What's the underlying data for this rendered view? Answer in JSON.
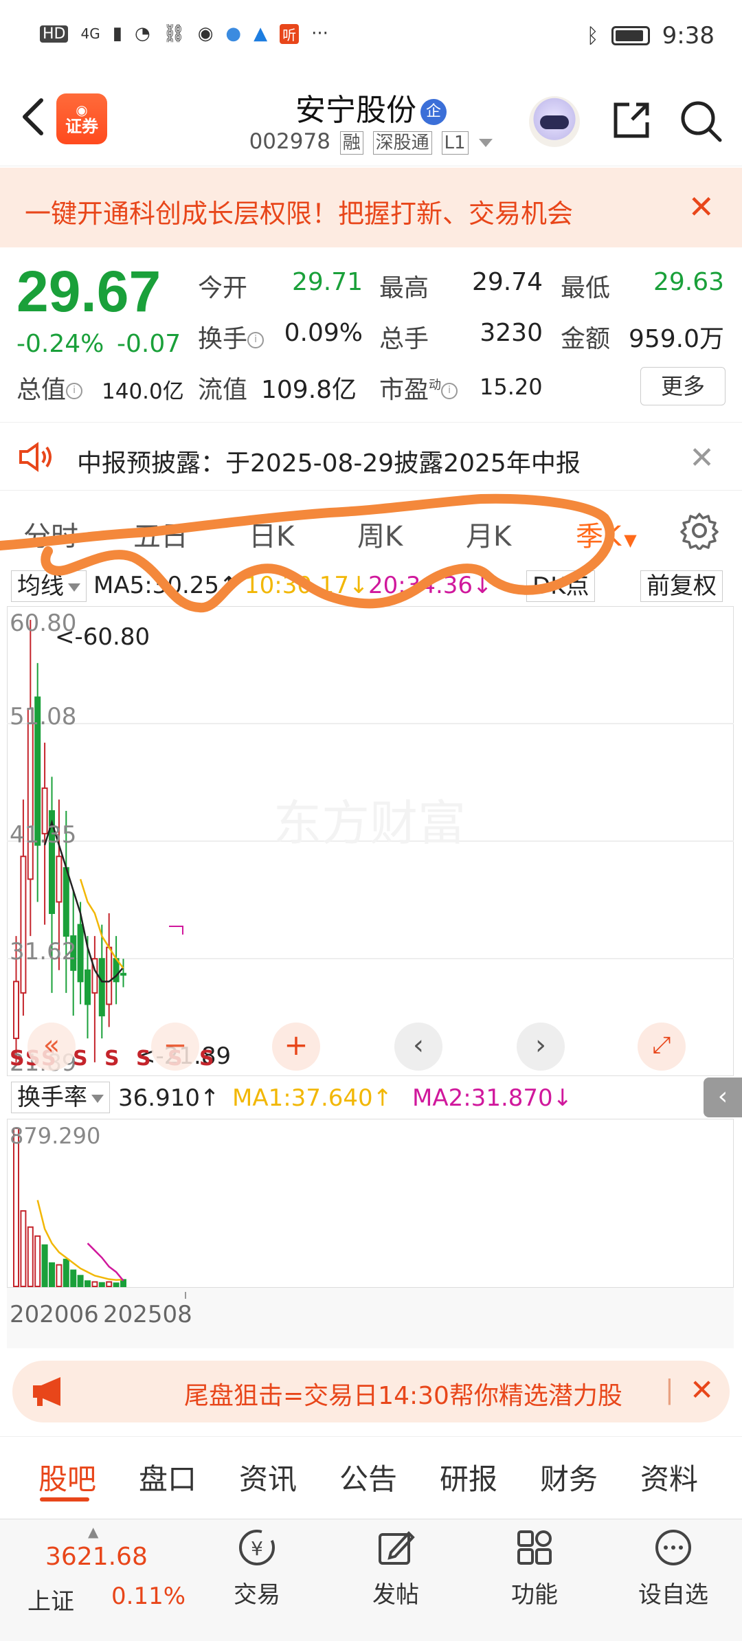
{
  "status": {
    "time": "9:38",
    "network": "4G",
    "hd": "HD",
    "more": "···"
  },
  "header": {
    "stock_name": "安宁股份",
    "badge": "企",
    "code": "002978",
    "tags": [
      "融",
      "深股通",
      "L1"
    ],
    "logo_text": "证券"
  },
  "promo": {
    "text": "一键开通科创成长层权限！把握打新、交易机会",
    "close": "✕"
  },
  "quote": {
    "price": "29.67",
    "change_pct": "-0.24%",
    "change_amt": "-0.07",
    "open_label": "今开",
    "open": "29.71",
    "high_label": "最高",
    "high": "29.74",
    "low_label": "最低",
    "low": "29.63",
    "turnover_label": "换手",
    "turnover": "0.09%",
    "volume_label": "总手",
    "volume": "3230",
    "amount_label": "金额",
    "amount": "959.0万",
    "mktcap_label": "总值",
    "mktcap": "140.0亿",
    "float_label": "流值",
    "float": "109.8亿",
    "pe_label": "市盈",
    "pe_sup": "动",
    "pe": "15.20",
    "more": "更多"
  },
  "notice": {
    "text": "中报预披露：于2025-08-29披露2025年中报",
    "close": "✕"
  },
  "ktabs": [
    "分时",
    "五日",
    "日K",
    "周K",
    "月K",
    "季K"
  ],
  "ktab_active": "季K",
  "ma": {
    "selector": "均线",
    "ma5": "MA5:30.25↑",
    "ma10": "10:30.17↓",
    "ma20": "20:34.36↓",
    "dk": "DK点",
    "adjust": "前复权",
    "colors": {
      "ma5": "#222222",
      "ma10": "#f2b705",
      "ma20": "#d0189c"
    }
  },
  "chart_labels": {
    "high_mark": "<-60.80",
    "low_mark": "<-21.89",
    "y_ticks": [
      "60.80",
      "51.08",
      "41.35",
      "31.62",
      "21.89"
    ],
    "watermark": "东方财富",
    "sell_marks": "S"
  },
  "volume": {
    "selector": "换手率",
    "value": "36.910↑",
    "ma1": "MA1:37.640↑",
    "ma2": "MA2:31.870↓",
    "max_tick": "879.290",
    "x_start": "202006",
    "x_end": "202508"
  },
  "snipe": {
    "text": "尾盘狙击=交易日14:30帮你精选潜力股",
    "sep": "|",
    "close": "✕"
  },
  "subtabs": [
    "股吧",
    "盘口",
    "资讯",
    "公告",
    "研报",
    "财务",
    "资料"
  ],
  "subtab_active": "股吧",
  "bottomnav": {
    "index_value": "3621.68",
    "index_name": "上证",
    "index_change": "0.11%",
    "items": [
      "交易",
      "发帖",
      "功能",
      "设自选"
    ]
  },
  "chart_data": {
    "type": "candlestick",
    "ylim": [
      21.89,
      60.8
    ],
    "ytick_labels": [
      "60.80",
      "51.08",
      "41.35",
      "31.62",
      "21.89"
    ],
    "candles": [
      {
        "o": 24,
        "c": 29,
        "h": 33,
        "l": 21.9,
        "up": true
      },
      {
        "o": 28,
        "c": 40,
        "h": 45,
        "l": 26,
        "up": true
      },
      {
        "o": 38,
        "c": 53,
        "h": 60.8,
        "l": 33,
        "up": true
      },
      {
        "o": 54,
        "c": 41,
        "h": 57,
        "l": 36,
        "up": false
      },
      {
        "o": 42,
        "c": 46,
        "h": 50,
        "l": 34,
        "up": true
      },
      {
        "o": 44,
        "c": 35,
        "h": 47,
        "l": 28,
        "up": false
      },
      {
        "o": 36,
        "c": 40,
        "h": 45,
        "l": 30,
        "up": true
      },
      {
        "o": 39,
        "c": 33,
        "h": 44,
        "l": 28,
        "up": false
      },
      {
        "o": 33,
        "c": 30,
        "h": 37,
        "l": 26,
        "up": false
      },
      {
        "o": 34,
        "c": 29,
        "h": 36,
        "l": 27,
        "up": false
      },
      {
        "o": 30,
        "c": 27,
        "h": 33,
        "l": 24,
        "up": false
      },
      {
        "o": 28,
        "c": 31,
        "h": 33,
        "l": 21.9,
        "up": true
      },
      {
        "o": 31,
        "c": 26,
        "h": 34,
        "l": 24,
        "up": false
      },
      {
        "o": 27,
        "c": 32,
        "h": 35,
        "l": 25,
        "up": true
      },
      {
        "o": 31,
        "c": 29,
        "h": 33,
        "l": 27,
        "up": false
      },
      {
        "o": 29.7,
        "c": 29.67,
        "h": 31,
        "l": 28.5,
        "up": false
      }
    ],
    "ma5": [
      null,
      null,
      null,
      null,
      41,
      43,
      41,
      39,
      37,
      35,
      32,
      30,
      29,
      29,
      29.5,
      30.25
    ],
    "ma10": [
      null,
      null,
      null,
      null,
      null,
      null,
      null,
      null,
      null,
      38,
      36,
      35,
      33,
      32,
      31,
      30.17
    ],
    "ma20": [],
    "turnover": [
      879.29,
      420,
      330,
      280,
      230,
      130,
      120,
      150,
      90,
      60,
      30,
      25,
      20,
      25,
      18,
      36.91
    ],
    "turnover_up": [
      true,
      true,
      true,
      true,
      false,
      false,
      true,
      false,
      false,
      false,
      false,
      true,
      false,
      true,
      false,
      false
    ],
    "turnover_ma1": [
      null,
      null,
      null,
      480,
      320,
      240,
      190,
      160,
      130,
      100,
      80,
      60,
      50,
      40,
      36,
      37.64
    ],
    "turnover_ma2": [
      null,
      null,
      null,
      null,
      null,
      null,
      null,
      null,
      null,
      null,
      240,
      200,
      160,
      110,
      80,
      31.87
    ]
  }
}
